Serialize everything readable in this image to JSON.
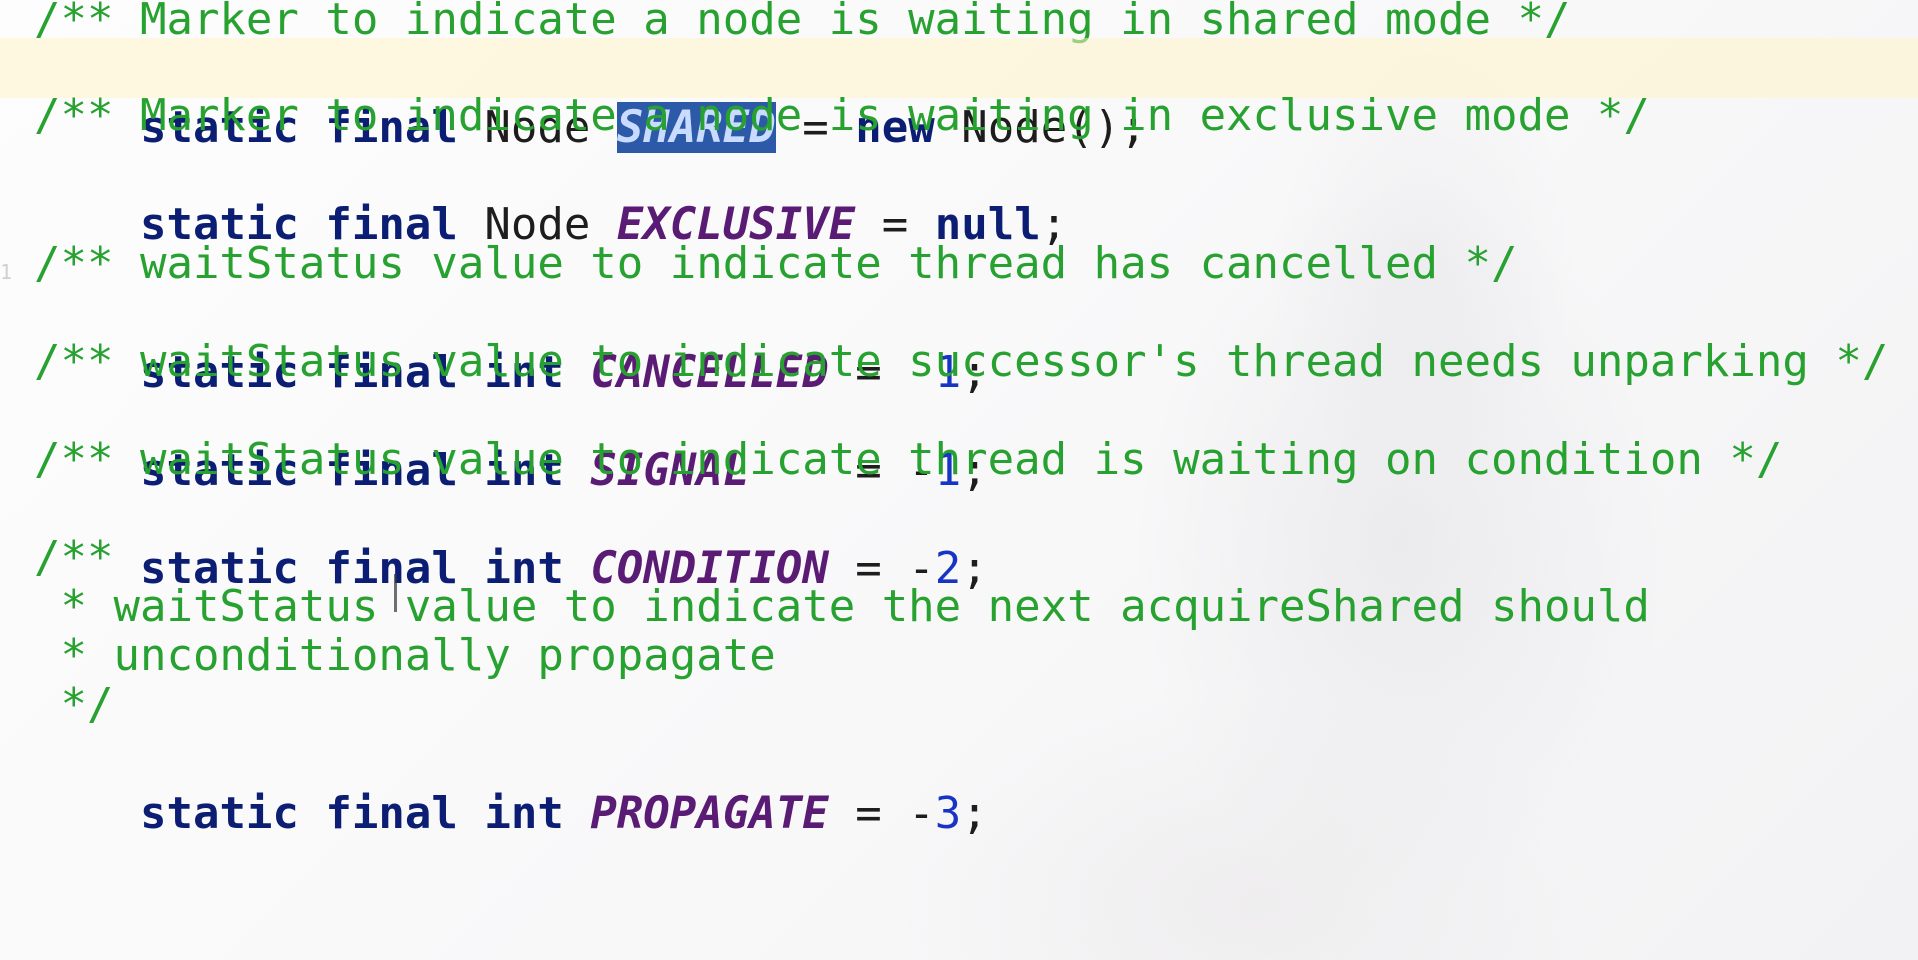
{
  "editor": {
    "lines": {
      "l1": {
        "comment": "/** Marker to indicate a node is waiting in shared mode */"
      },
      "l2": {
        "kw": "static final",
        "type": " Node ",
        "field": "SHARED",
        "eq": " = ",
        "new": "new",
        "rest": " Node();"
      },
      "l3": {
        "comment": "/** Marker to indicate a node is waiting in exclusive mode */"
      },
      "l4": {
        "kw": "static final",
        "type": " Node ",
        "field": "EXCLUSIVE",
        "eq": " = ",
        "val": "null",
        "semi": ";"
      },
      "l5": {
        "comment": "/** waitStatus value to indicate thread has cancelled */"
      },
      "l6": {
        "kw": "static final int",
        "field": "CANCELLED",
        "eq": " =  ",
        "num": "1",
        "semi": ";"
      },
      "l7": {
        "comment": "/** waitStatus value to indicate successor's thread needs unparking */"
      },
      "l8": {
        "kw": "static final int",
        "field": "SIGNAL",
        "eq": "    = -",
        "num": "1",
        "semi": ";"
      },
      "l9": {
        "comment": "/** waitStatus value to indicate thread is waiting on condition */"
      },
      "l10": {
        "kw": "static final int",
        "field": "CONDITION",
        "eq": " = -",
        "num": "2",
        "semi": ";"
      },
      "l11": {
        "comment": "/**"
      },
      "l12": {
        "comment": " * waitStatus value to indicate the next acquireShared should"
      },
      "l13": {
        "comment": " * unconditionally propagate"
      },
      "l14": {
        "comment": " */"
      },
      "l15": {
        "kw": "static final int",
        "field": "PROPAGATE",
        "eq": " = -",
        "num": "3",
        "semi": ";"
      }
    },
    "gutter_mark": "1"
  }
}
